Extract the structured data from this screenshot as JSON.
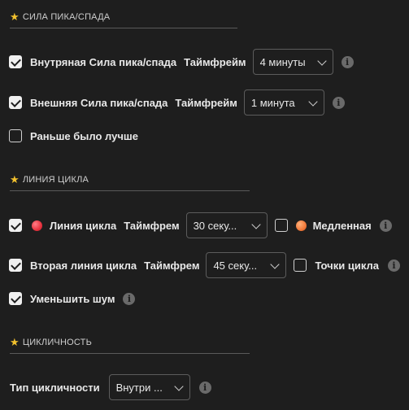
{
  "colors": {
    "accent_star": "#f2c12e",
    "dot_red": "#e8333f",
    "dot_orange": "#f37a3a"
  },
  "sections": {
    "peak": {
      "title": "СИЛА ПИКА/СПАДА"
    },
    "cycle_line": {
      "title": "ЛИНИЯ ЦИКЛА"
    },
    "cyclicity": {
      "title": "ЦИКЛИЧНОСТЬ"
    }
  },
  "peak": {
    "inner": {
      "label": "Внутряная Сила пика/спада",
      "tf_label": "Таймфрейм",
      "value": "4 минуты",
      "checked": true
    },
    "outer": {
      "label": "Внешняя Сила пика/спада",
      "tf_label": "Таймфрейм",
      "value": "1 минута",
      "checked": true
    },
    "earlier": {
      "label": "Раньше было лучше",
      "checked": false
    }
  },
  "cycle": {
    "line": {
      "label": "Линия цикла",
      "tf_label": "Таймфрем",
      "value": "30 секу...",
      "checked": true
    },
    "slow": {
      "label": "Медленная",
      "checked": false
    },
    "second": {
      "label": "Вторая линия цикла",
      "tf_label": "Таймфрем",
      "value": "45 секу...",
      "checked": true
    },
    "points": {
      "label": "Точки цикла",
      "checked": false
    },
    "noise": {
      "label": "Уменьшить шум",
      "checked": true
    }
  },
  "cyclicity": {
    "type_label": "Тип цикличности",
    "value": "Внутри ..."
  },
  "icons": {
    "info": "i",
    "star": "★"
  }
}
